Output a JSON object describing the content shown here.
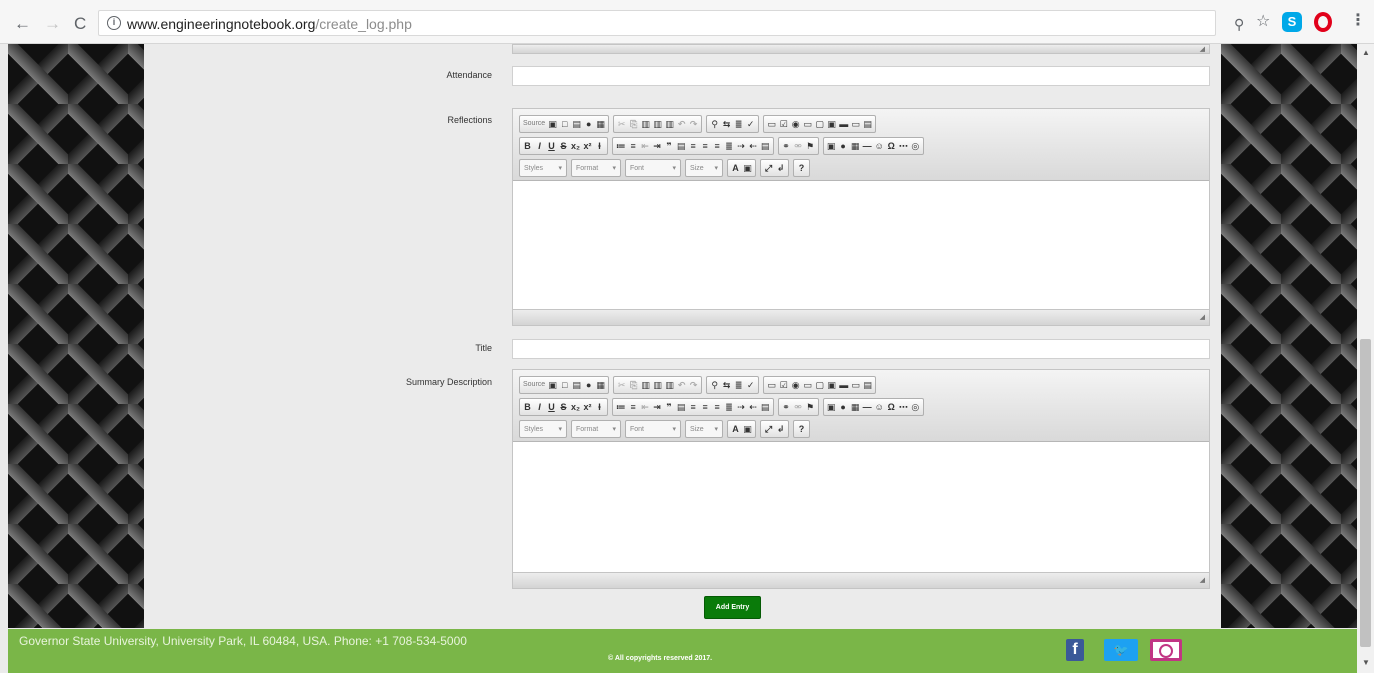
{
  "browser": {
    "url_host": "www.engineeringnotebook.org",
    "url_path": "/create_log.php",
    "back_icon": "←",
    "forward_icon": "→",
    "reload_icon": "C",
    "info_icon": "i",
    "zoom_icon": "⚲",
    "star_icon": "☆",
    "skype_icon": "S",
    "menu_icon": "⋮"
  },
  "form": {
    "attendance_label": "Attendance",
    "reflections_label": "Reflections",
    "title_label": "Title",
    "summary_label": "Summary Description",
    "add_button_label": "Add Entry"
  },
  "editor": {
    "source_label": "Source",
    "styles_label": "Styles",
    "format_label": "Format",
    "font_label": "Font",
    "size_label": "Size",
    "bold": "B",
    "italic": "I",
    "underline": "U",
    "strike": "S",
    "subscript": "x₂",
    "superscript": "x²",
    "text_color": "A",
    "help": "?"
  },
  "footer": {
    "address": "Governor State University, University Park, IL 60484, USA. Phone: +1 708-534-5000",
    "copyright": "© All copyrights reserved 2017.",
    "facebook_icon": "f",
    "twitter_icon": "🐦"
  },
  "colors": {
    "footer_bg": "#7ab648",
    "add_button": "#0a7b0a",
    "page_bg": "#ebebeb"
  }
}
